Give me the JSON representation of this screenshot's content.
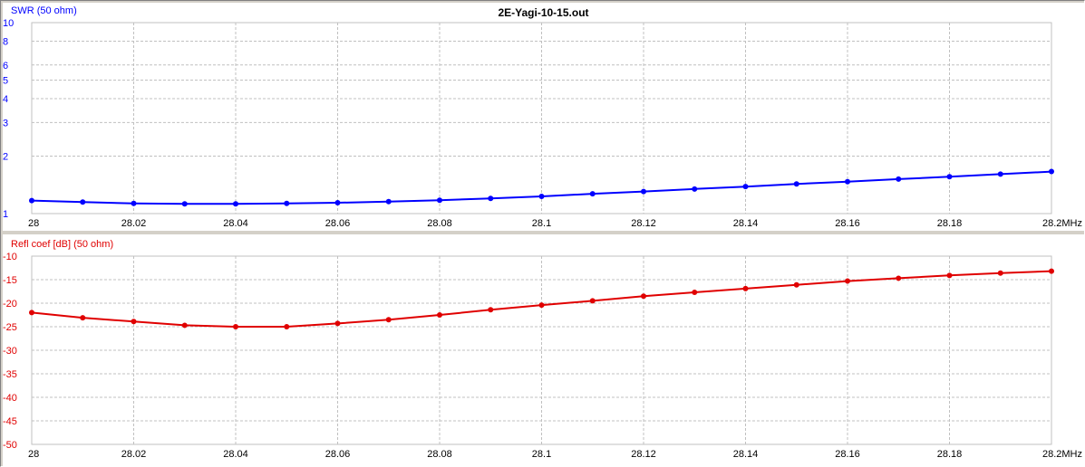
{
  "window": {
    "title": "2E-Yagi-10-15.out"
  },
  "colors": {
    "swr": "#0000ff",
    "refl": "#e00000",
    "grid": "#c0c0c0",
    "panel_bg": "#ffffff",
    "window_bg": "#d4d0c8"
  },
  "chart_data": [
    {
      "type": "line",
      "title": "2E-Yagi-10-15.out",
      "ylabel": "SWR (50 ohm)",
      "xlabel": "",
      "x_unit": "MHz",
      "y_scale": "log",
      "grid": true,
      "xlim": [
        28,
        28.2
      ],
      "ylim": [
        1,
        10
      ],
      "x_ticks": [
        28,
        28.02,
        28.04,
        28.06,
        28.08,
        28.1,
        28.12,
        28.14,
        28.16,
        28.18,
        28.2
      ],
      "x_tick_labels": [
        "28",
        "28.02",
        "28.04",
        "28.06",
        "28.08",
        "28.1",
        "28.12",
        "28.14",
        "28.16",
        "28.18",
        "28.2MHz"
      ],
      "y_ticks": [
        1,
        2,
        3,
        4,
        5,
        6,
        8,
        10
      ],
      "y_tick_labels": [
        "1",
        "2",
        "3",
        "4",
        "5",
        "6",
        "8",
        "10"
      ],
      "series": [
        {
          "x": [
            28,
            28.01,
            28.02,
            28.03,
            28.04,
            28.05,
            28.06,
            28.07,
            28.08,
            28.09,
            28.1,
            28.11,
            28.12,
            28.13,
            28.14,
            28.15,
            28.16,
            28.17,
            28.18,
            28.19,
            28.2
          ],
          "values": [
            1.17,
            1.15,
            1.13,
            1.125,
            1.125,
            1.13,
            1.14,
            1.155,
            1.175,
            1.2,
            1.23,
            1.27,
            1.305,
            1.345,
            1.385,
            1.43,
            1.47,
            1.515,
            1.56,
            1.61,
            1.66
          ]
        }
      ]
    },
    {
      "type": "line",
      "ylabel": "Refl coef [dB] (50 ohm)",
      "xlabel": "",
      "x_unit": "MHz",
      "grid": true,
      "xlim": [
        28,
        28.2
      ],
      "ylim": [
        -50,
        -10
      ],
      "x_ticks": [
        28,
        28.02,
        28.04,
        28.06,
        28.08,
        28.1,
        28.12,
        28.14,
        28.16,
        28.18,
        28.2
      ],
      "x_tick_labels": [
        "28",
        "28.02",
        "28.04",
        "28.06",
        "28.08",
        "28.1",
        "28.12",
        "28.14",
        "28.16",
        "28.18",
        "28.2MHz"
      ],
      "y_ticks": [
        -10,
        -15,
        -20,
        -25,
        -30,
        -35,
        -40,
        -45,
        -50
      ],
      "y_tick_labels": [
        "-10",
        "-15",
        "-20",
        "-25",
        "-30",
        "-35",
        "-40",
        "-45",
        "-50"
      ],
      "series": [
        {
          "x": [
            28,
            28.01,
            28.02,
            28.03,
            28.04,
            28.05,
            28.06,
            28.07,
            28.08,
            28.09,
            28.1,
            28.11,
            28.12,
            28.13,
            28.14,
            28.15,
            28.16,
            28.17,
            28.18,
            28.19,
            28.2
          ],
          "values": [
            -22.0,
            -23.1,
            -23.9,
            -24.7,
            -25.0,
            -25.0,
            -24.3,
            -23.5,
            -22.5,
            -21.4,
            -20.4,
            -19.5,
            -18.5,
            -17.7,
            -16.9,
            -16.1,
            -15.3,
            -14.7,
            -14.1,
            -13.6,
            -13.2
          ]
        }
      ]
    }
  ]
}
